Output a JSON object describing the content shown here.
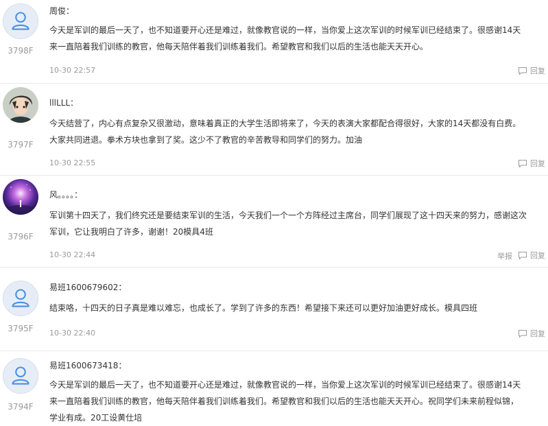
{
  "comments": [
    {
      "username": "周俊：",
      "floor": "3798F",
      "content_lines": [
        "今天是军训的最后一天了，也不知道要开心还是难过，就像教官说的一样，当你爱上这次军训的时候军训已经结束了。很感谢14天",
        "来一直陪着我们训练的教官，他每天陪伴着我们训练着我们。希望教官和我们以后的生活也能天天开心。"
      ],
      "time": "10-30 22:57",
      "reply_label": "回复"
    },
    {
      "username": "lllLLL：",
      "floor": "3797F",
      "content_lines": [
        "今天结营了，内心有点复杂又很激动，意味着真正的大学生活即将来了，今天的表演大家都配合得很好，大家的14天都没有白费。",
        "大家共同进退。拳术方块也拿到了奖。这少不了教官的辛苦教导和同学们的努力。加油"
      ],
      "time": "10-30 22:55",
      "reply_label": "回复"
    },
    {
      "username": "风。。。。：",
      "floor": "3796F",
      "content_lines": [
        "军训第十四天了，我们终究还是要结束军训的生活，今天我们一个一个方阵经过主席台，同学们展现了这十四天来的努力，感谢这次",
        "军训，它让我明白了许多，谢谢！20模具4班"
      ],
      "time": "10-30 22:44",
      "report_label": "举报",
      "reply_label": "回复"
    },
    {
      "username": "易班1600679602：",
      "floor": "3795F",
      "content_lines": [
        "结束咯，十四天的日子真是难以难忘，也成长了。学到了许多的东西！希望接下来还可以更好加油更好成长。模具四班"
      ],
      "time": "10-30 22:40",
      "reply_label": "回复"
    },
    {
      "username": "易班1600673418：",
      "floor": "3794F",
      "content_lines": [
        "今天是军训的最后一天了，也不知道要开心还是难过，就像教官说的一样，当你爱上这次军训的时候军训已经结束了。很感谢14天",
        "来一直陪着我们训练的教官，他每天陪伴着我们训练着我们。希望教官和我们以后的生活也能天天开心。祝同学们未来前程似锦，",
        "学业有成。20工设黄仕培"
      ]
    }
  ],
  "icons": {
    "default_avatar": "user-silhouette-icon",
    "reply": "speech-bubble-icon"
  },
  "colors": {
    "text": "#333333",
    "meta": "#9a9a9a",
    "divider": "#e9e9e9",
    "avatar_bg": "#e7edf7",
    "avatar_icon": "#4a90e2"
  }
}
